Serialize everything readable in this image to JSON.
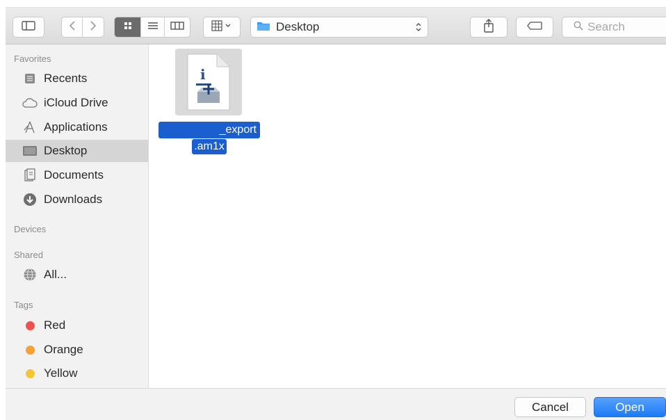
{
  "toolbar": {
    "location": "Desktop",
    "search_placeholder": "Search",
    "icons": [
      "sidebar-toggle-icon",
      "back-icon",
      "forward-icon",
      "icon-view-icon",
      "list-view-icon",
      "column-view-icon",
      "group-icon",
      "folder-icon",
      "share-icon",
      "tag-icon",
      "search-icon"
    ]
  },
  "sidebar": {
    "favorites_title": "Favorites",
    "favorites": [
      {
        "label": "Recents",
        "icon": "recents-icon"
      },
      {
        "label": "iCloud Drive",
        "icon": "cloud-icon"
      },
      {
        "label": "Applications",
        "icon": "applications-icon"
      },
      {
        "label": "Desktop",
        "icon": "desktop-icon",
        "selected": true
      },
      {
        "label": "Documents",
        "icon": "documents-icon"
      },
      {
        "label": "Downloads",
        "icon": "downloads-icon"
      }
    ],
    "devices_title": "Devices",
    "shared_title": "Shared",
    "shared": [
      {
        "label": "All...",
        "icon": "network-icon"
      }
    ],
    "tags_title": "Tags",
    "tags": [
      {
        "label": "Red",
        "color": "#f0524a"
      },
      {
        "label": "Orange",
        "color": "#f5a134"
      },
      {
        "label": "Yellow",
        "color": "#f5c534"
      }
    ]
  },
  "content": {
    "file": {
      "name_line1": "_export",
      "name_line2": ".am1x",
      "selected": true
    }
  },
  "footer": {
    "cancel_label": "Cancel",
    "open_label": "Open"
  },
  "colors": {
    "accent": "#1d7bf5",
    "selection": "#1b5fcf"
  }
}
